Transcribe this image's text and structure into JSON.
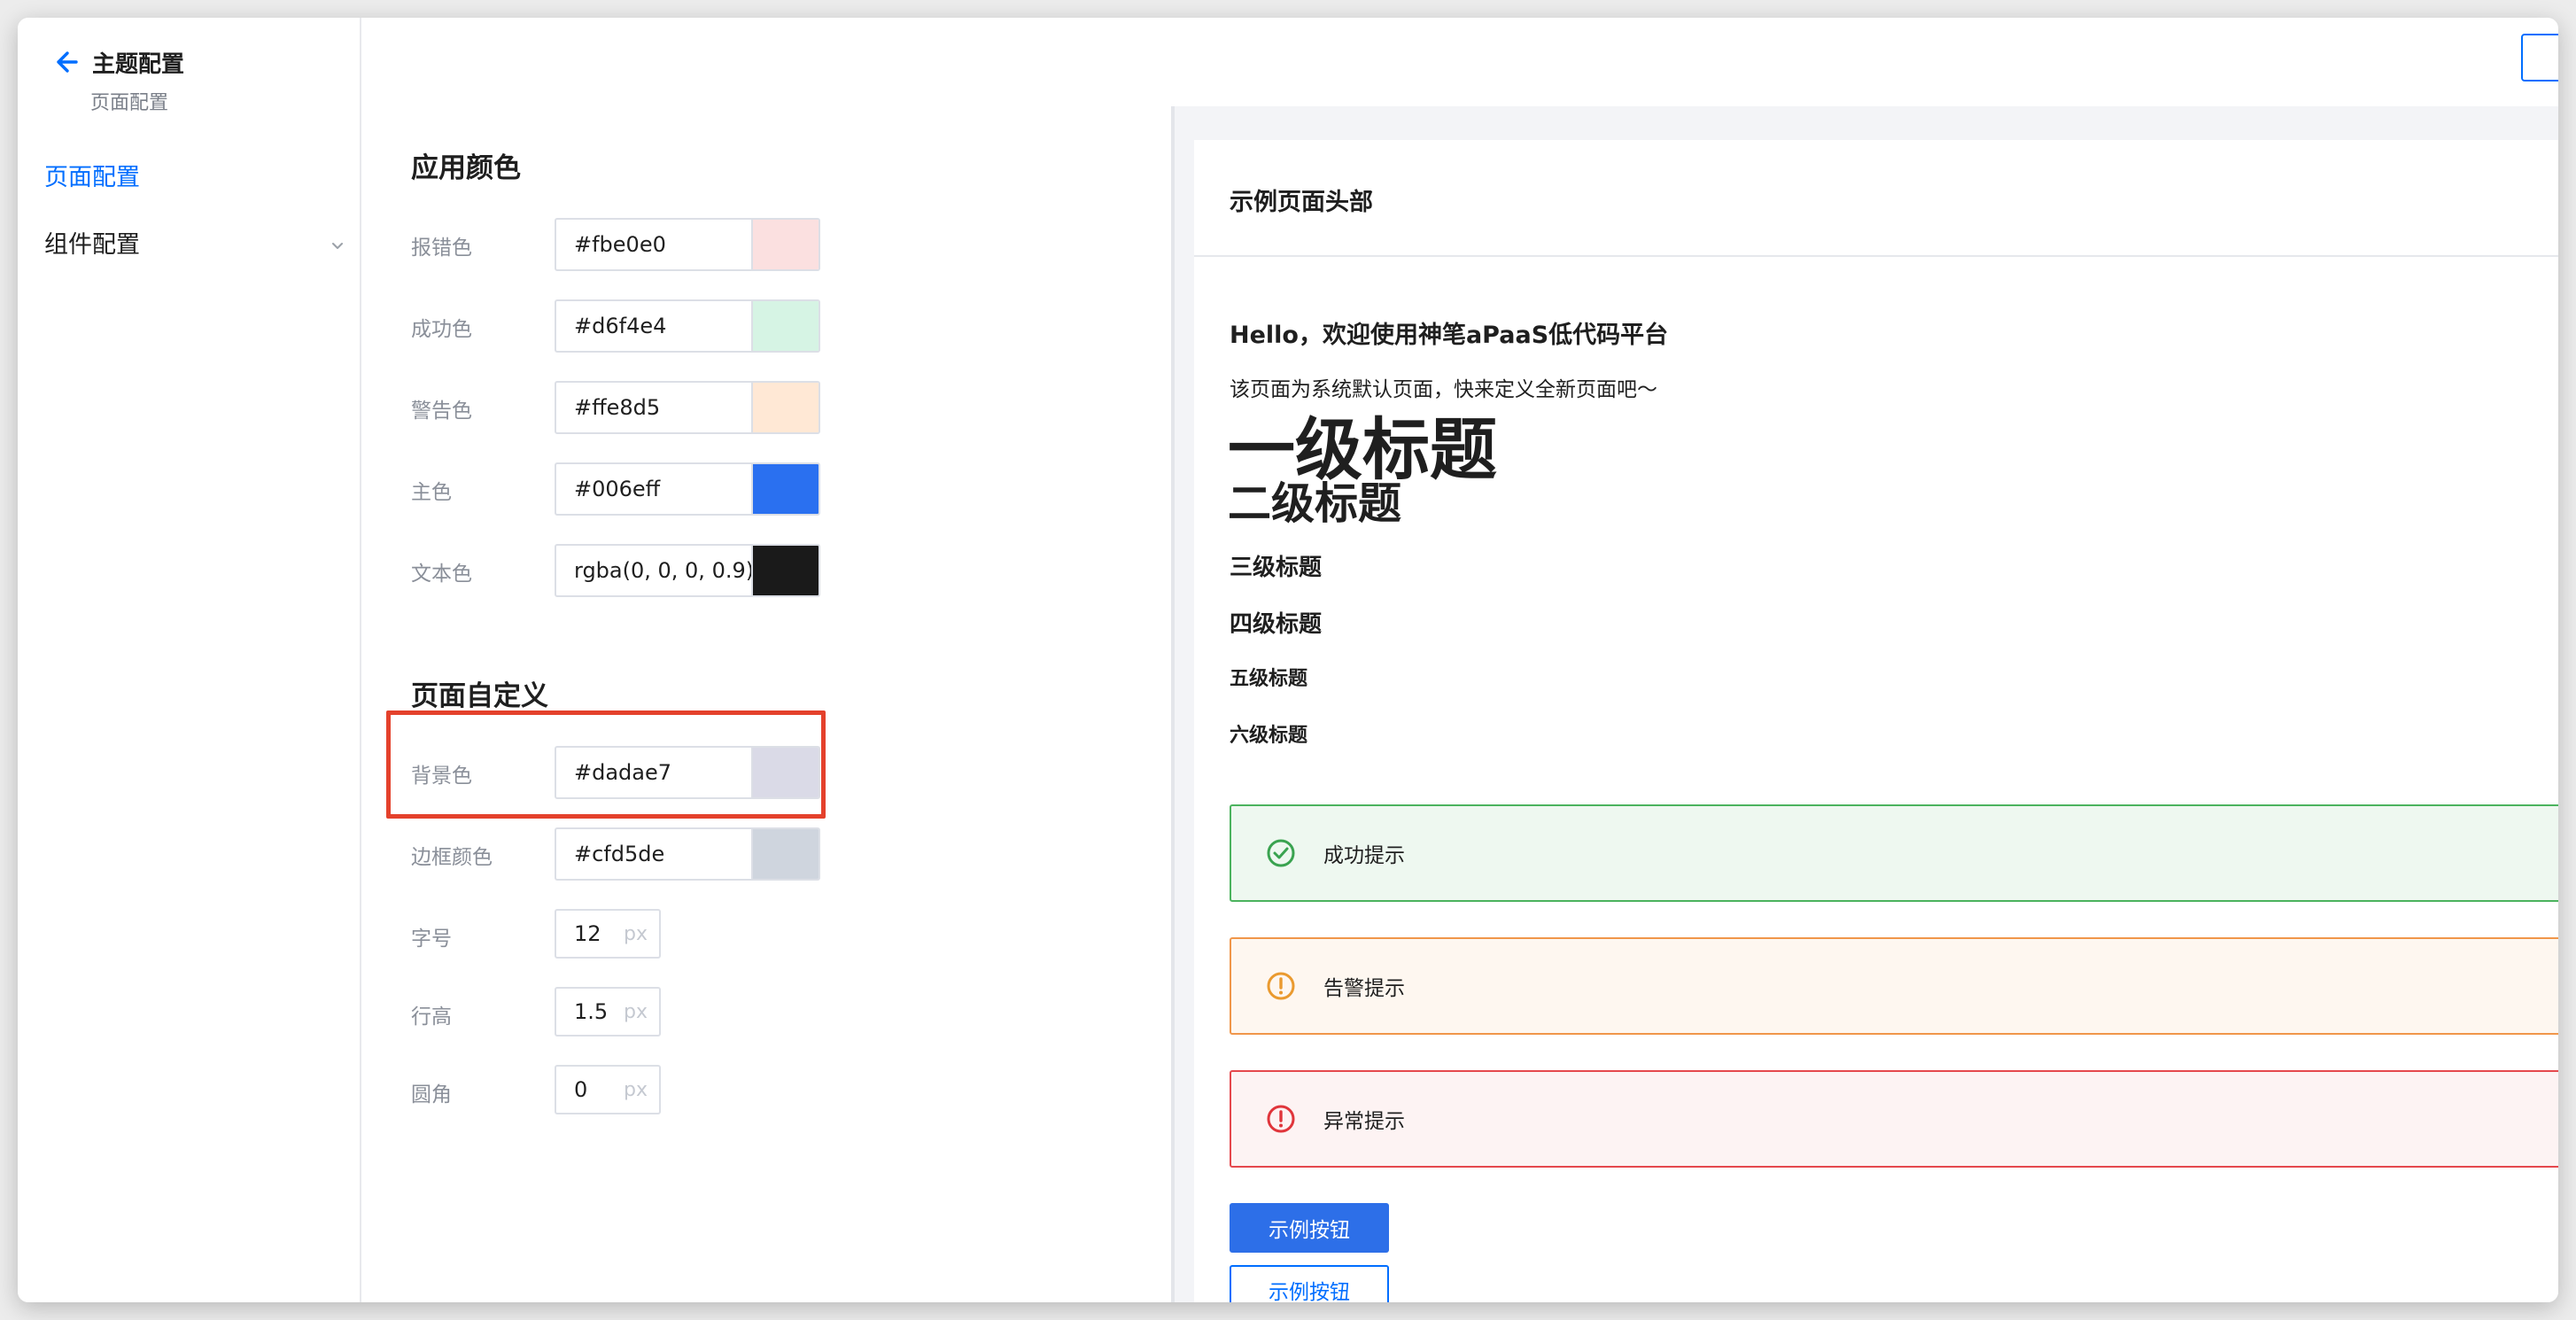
{
  "sidebar": {
    "title": "主题配置",
    "subtitle": "页面配置",
    "items": [
      {
        "label": "页面配置",
        "active": true
      },
      {
        "label": "组件配置",
        "active": false
      }
    ]
  },
  "settings": {
    "app_colors": {
      "title": "应用颜色",
      "rows": [
        {
          "label": "报错色",
          "value": "#fbe0e0",
          "swatch": "#fbe0e0"
        },
        {
          "label": "成功色",
          "value": "#d6f4e4",
          "swatch": "#d6f4e4"
        },
        {
          "label": "警告色",
          "value": "#ffe8d5",
          "swatch": "#ffe8d5"
        },
        {
          "label": "主色",
          "value": "#006eff",
          "swatch": "#006eff"
        },
        {
          "label": "文本色",
          "value": "rgba(0, 0, 0, 0.9)",
          "swatch": "#1a1a1a"
        }
      ]
    },
    "page_custom": {
      "title": "页面自定义",
      "color_rows": [
        {
          "label": "背景色",
          "value": "#dadae7",
          "swatch": "#dadae7"
        },
        {
          "label": "边框颜色",
          "value": "#cfd5de",
          "swatch": "#cfd5de"
        }
      ],
      "number_rows": [
        {
          "label": "字号",
          "value": "12",
          "unit": "px"
        },
        {
          "label": "行高",
          "value": "1.5",
          "unit": "px"
        },
        {
          "label": "圆角",
          "value": "0",
          "unit": "px"
        }
      ]
    }
  },
  "preview": {
    "header": "示例页面头部",
    "hello": "Hello，欢迎使用神笔aPaaS低代码平台",
    "description": "该页面为系统默认页面，快来定义全新页面吧～",
    "h1": "一级标题",
    "h2": "二级标题",
    "h3": "三级标题",
    "h4": "四级标题",
    "h5": "五级标题",
    "h6": "六级标题",
    "alerts": {
      "success": "成功提示",
      "warning": "告警提示",
      "error": "异常提示"
    },
    "primary_button": "示例按钮",
    "outline_button": "示例按钮"
  },
  "colors": {
    "accent": "#006eff",
    "highlight_box": "#e4412c",
    "success": "#4bb35e",
    "warning": "#f0964a",
    "error": "#e5484d"
  }
}
